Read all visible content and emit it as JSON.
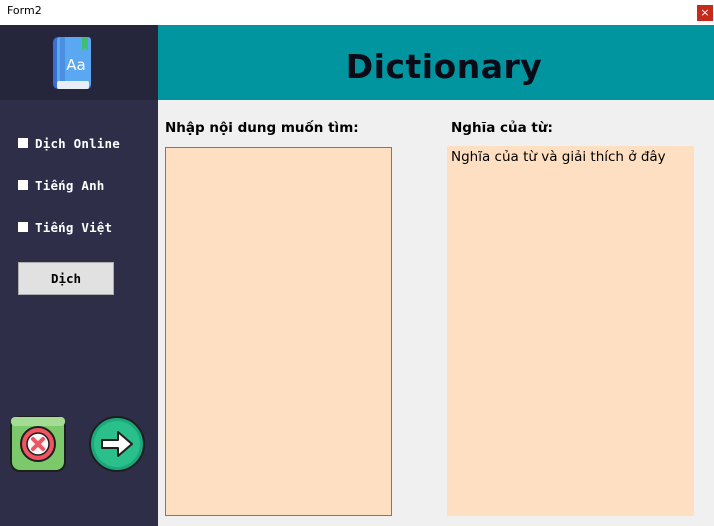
{
  "window": {
    "title": "Form2",
    "close_glyph": "×"
  },
  "logo": {
    "icon": "dictionary-book-icon",
    "glyph": "Aa"
  },
  "sidebar": {
    "options": [
      {
        "label": "Dịch Online",
        "checked": false
      },
      {
        "label": "Tiếng Anh",
        "checked": false
      },
      {
        "label": "Tiếng Việt",
        "checked": false
      }
    ],
    "translate_button": "Dịch",
    "exit_icon": "close-circle-icon",
    "next_icon": "arrow-right-circle-icon"
  },
  "header": {
    "title": "Dictionary"
  },
  "input": {
    "label": "Nhập nội dung muốn tìm:",
    "value": ""
  },
  "output": {
    "label": "Nghĩa của từ:",
    "text": "Nghĩa của từ và giải thích ở đây"
  },
  "colors": {
    "sidebar": "#2e2e49",
    "logo_bg": "#25253c",
    "header": "#00959f",
    "text_area": "#ffdfc1",
    "exit_button": "#7cc96b",
    "exit_inner": "#ef5462",
    "next_button": "#19a97b"
  }
}
